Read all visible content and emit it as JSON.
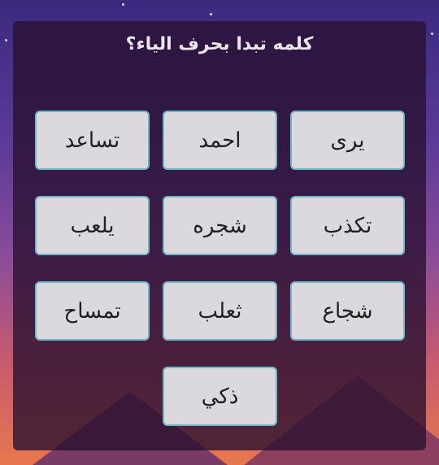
{
  "question": {
    "text": "كلمه تبدا بحرف الياء؟"
  },
  "options": [
    {
      "label": "يرى"
    },
    {
      "label": "احمد"
    },
    {
      "label": "تساعد"
    },
    {
      "label": "تكذب"
    },
    {
      "label": "شجره"
    },
    {
      "label": "يلعب"
    },
    {
      "label": "شجاع"
    },
    {
      "label": "ثعلب"
    },
    {
      "label": "تمساح"
    },
    {
      "label": "ذكي"
    }
  ],
  "colors": {
    "panel": "#28102e",
    "option_bg": "#dbd8de",
    "option_border": "#6fb8c6",
    "title": "#ece6ee"
  }
}
